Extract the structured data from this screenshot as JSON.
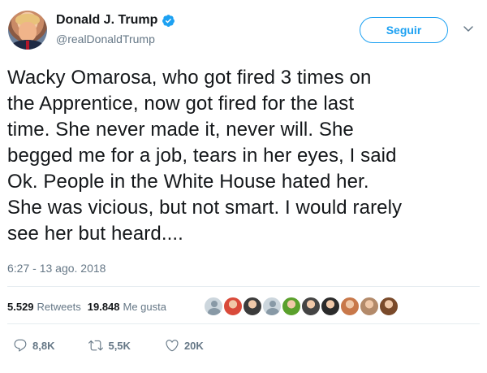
{
  "author": {
    "display_name": "Donald J. Trump",
    "handle": "@realDonaldTrump",
    "verified": true
  },
  "follow_button": {
    "label": "Seguir"
  },
  "tweet": {
    "lines": [
      "Wacky Omarosa, who got fired 3 times on",
      "the Apprentice, now got fired for the last",
      "time. She never made it, never will. She",
      "begged me for a job, tears in her eyes, I said",
      "Ok. People in the White House hated her.",
      "She was vicious, but not smart. I would rarely",
      "see her but heard...."
    ],
    "timestamp": "6:27 - 13 ago. 2018"
  },
  "stats": {
    "retweets_count": "5.529",
    "retweets_label": "Retweets",
    "likes_count": "19.848",
    "likes_label": "Me gusta"
  },
  "likers": [
    {
      "style": "default"
    },
    {
      "color": "#d94a3a"
    },
    {
      "color": "#3b3b3b"
    },
    {
      "style": "default"
    },
    {
      "color": "#5aa02c"
    },
    {
      "color": "#444444"
    },
    {
      "color": "#2b2b2b"
    },
    {
      "color": "#c8784a"
    },
    {
      "color": "#b38a6a"
    },
    {
      "color": "#7a4a2a"
    }
  ],
  "actions": {
    "reply_count": "8,8K",
    "retweet_count": "5,5K",
    "like_count": "20K"
  },
  "colors": {
    "accent": "#1da1f2",
    "muted": "#657786",
    "text": "#14171a",
    "divider": "#e6ecf0"
  },
  "icons": [
    "verified-badge-icon",
    "chevron-down-icon",
    "reply-icon",
    "retweet-icon",
    "heart-icon"
  ]
}
